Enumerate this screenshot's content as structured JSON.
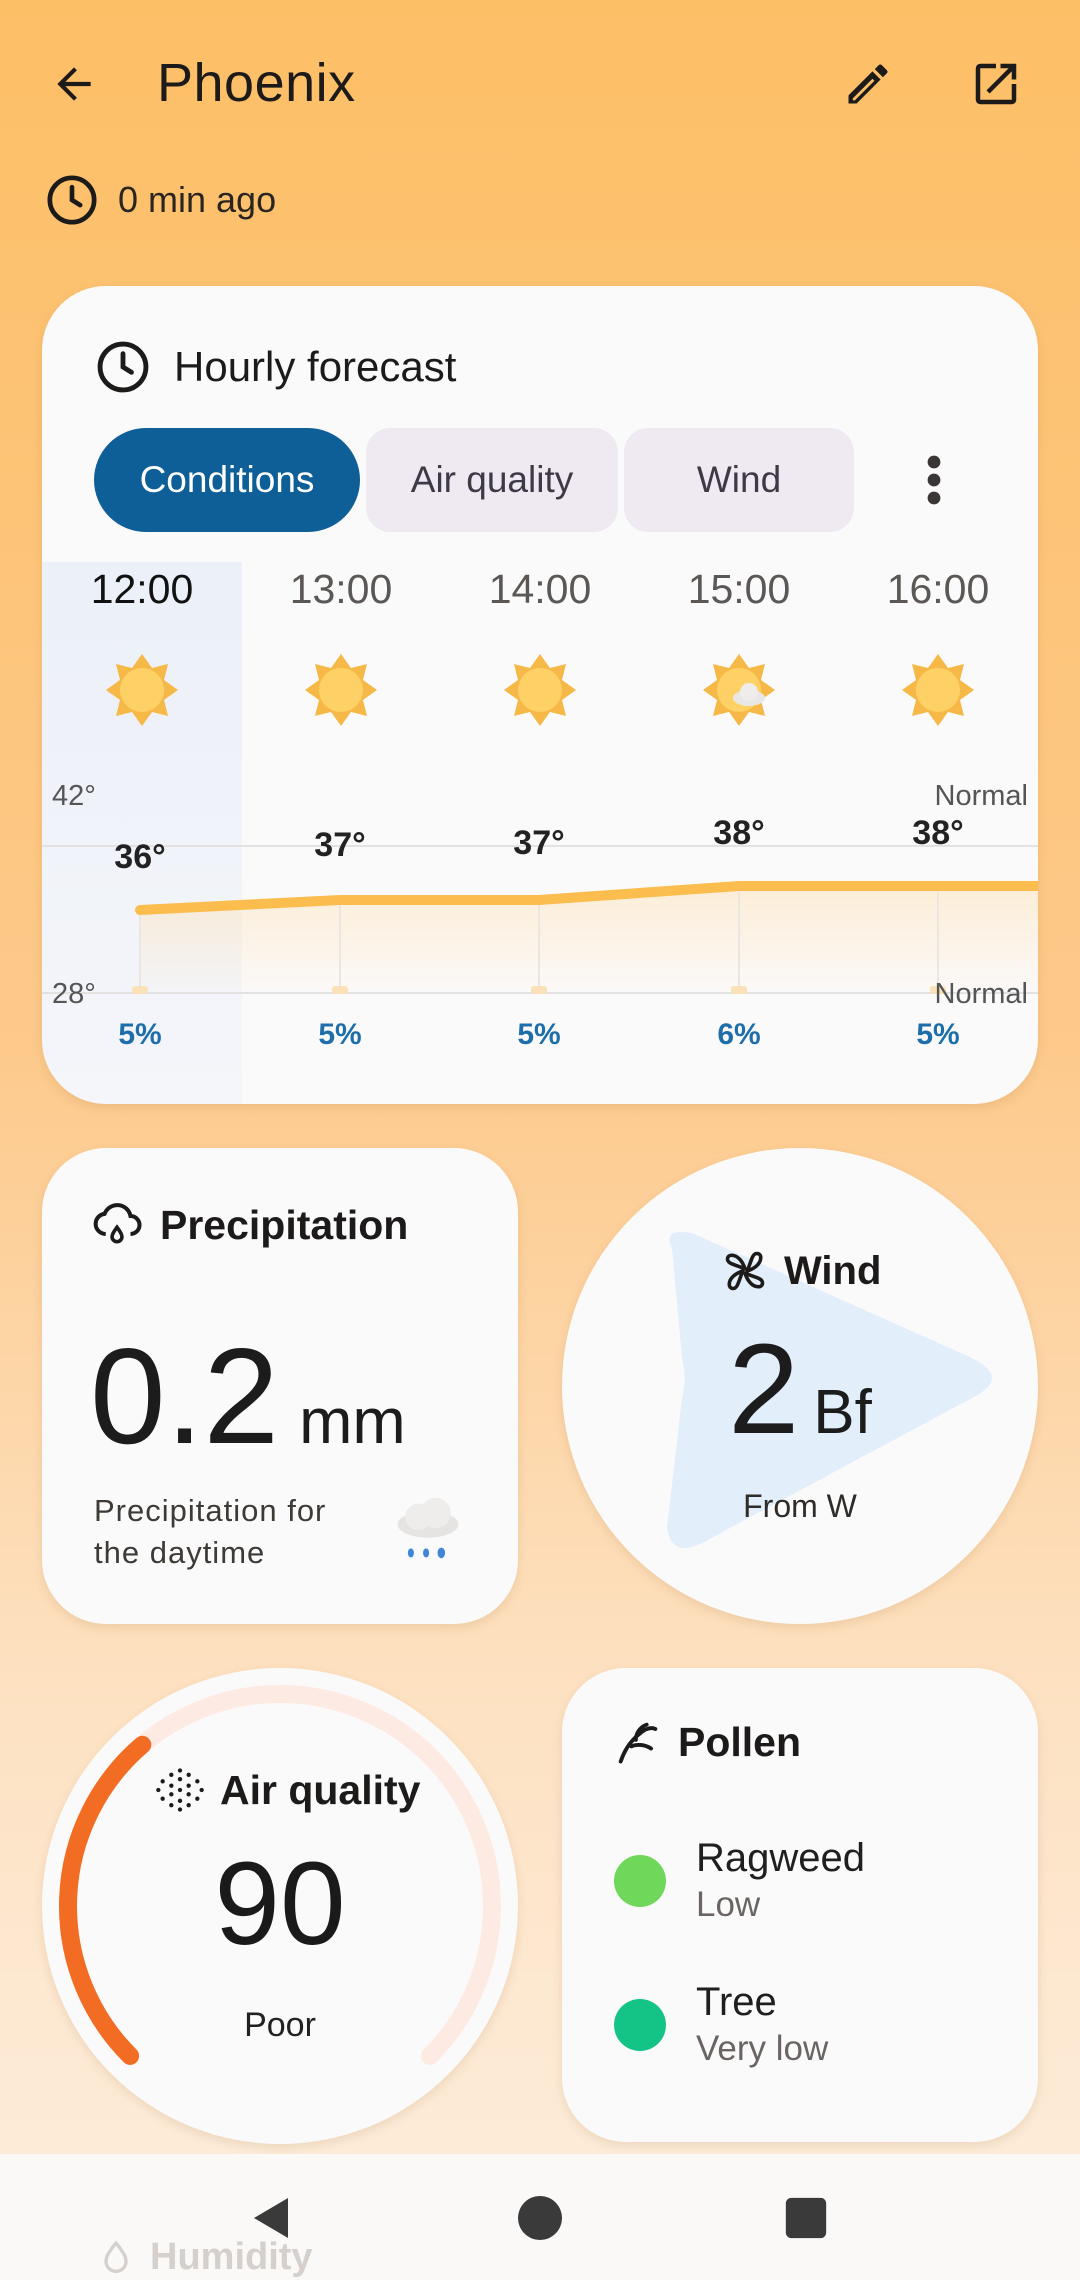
{
  "header": {
    "title": "Phoenix",
    "updated": "0 min ago",
    "icons": {
      "back": "arrow-left-icon",
      "edit": "pencil-icon",
      "open": "open-in-new-icon",
      "clock": "clock-icon"
    }
  },
  "hourly": {
    "title": "Hourly forecast",
    "tabs": [
      "Conditions",
      "Air quality",
      "Wind"
    ],
    "active_tab": "Conditions",
    "more_icon": "more-vert-icon",
    "hours": [
      {
        "time": "12:00",
        "icon": "sun-icon",
        "temp": "36°",
        "pop": "5%"
      },
      {
        "time": "13:00",
        "icon": "sun-icon",
        "temp": "37°",
        "pop": "5%"
      },
      {
        "time": "14:00",
        "icon": "sun-icon",
        "temp": "37°",
        "pop": "5%"
      },
      {
        "time": "15:00",
        "icon": "sun-cloud-icon",
        "temp": "38°",
        "pop": "6%"
      },
      {
        "time": "16:00",
        "icon": "sun-icon",
        "temp": "38°",
        "pop": "5%"
      }
    ],
    "scale": {
      "high": "42°",
      "low": "28°",
      "high_label": "Normal",
      "low_label": "Normal"
    }
  },
  "precipitation": {
    "title": "Precipitation",
    "value": "0.2",
    "unit": "mm",
    "description": "Precipitation for the daytime",
    "icon": "rain-cloud-icon"
  },
  "wind": {
    "title": "Wind",
    "value": "2",
    "unit": "Bf",
    "direction": "From W",
    "icon": "fan-icon"
  },
  "air_quality": {
    "title": "Air quality",
    "value": "90",
    "level": "Poor",
    "gauge_fraction": 0.35,
    "color": "#f26d23"
  },
  "pollen": {
    "title": "Pollen",
    "items": [
      {
        "name": "Ragweed",
        "level": "Low",
        "color": "#6fd85a"
      },
      {
        "name": "Tree",
        "level": "Very low",
        "color": "#14c487"
      }
    ]
  },
  "next_card": {
    "title": "Humidity"
  },
  "navigation": {
    "back": "nav-back-icon",
    "home": "nav-home-icon",
    "recents": "nav-recents-icon"
  },
  "colors": {
    "accent": "#0e5f98",
    "chip_bg": "#efe9f2",
    "temp_line": "#fbbd4d",
    "pop_text": "#1e6fa9"
  }
}
